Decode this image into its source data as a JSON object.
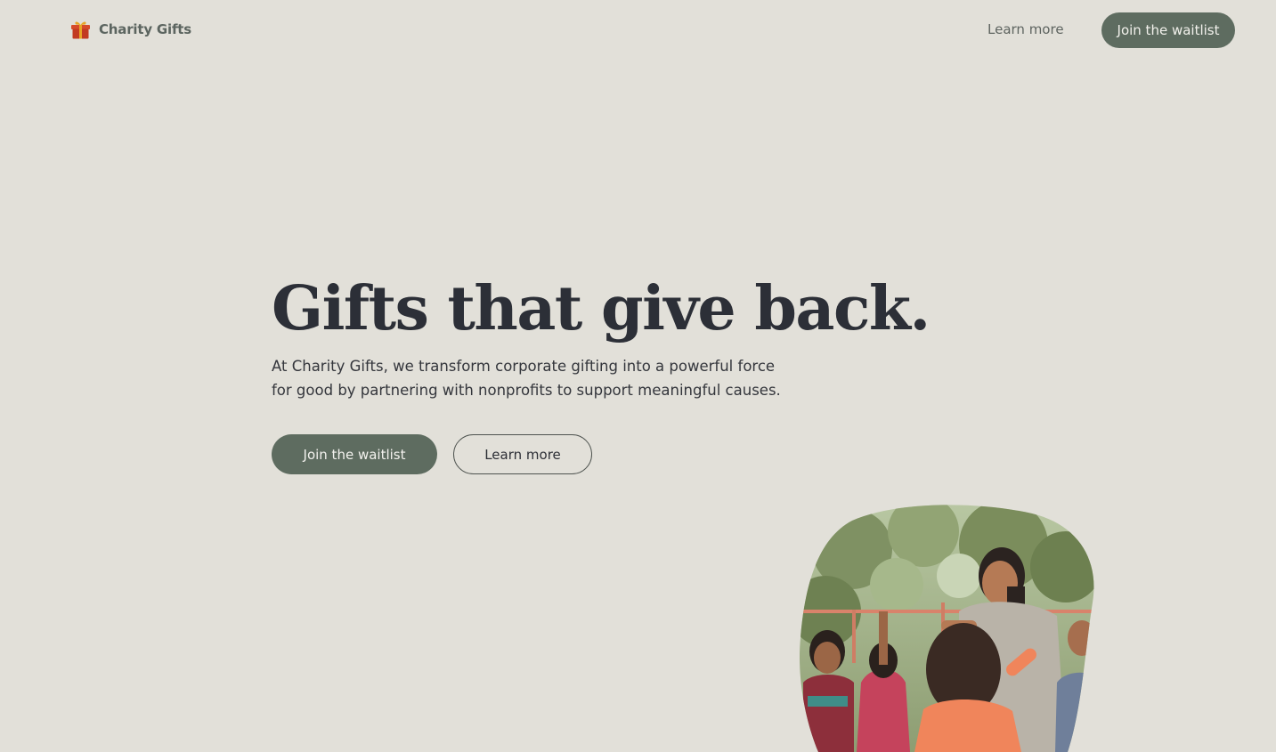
{
  "header": {
    "brand_name": "Charity Gifts",
    "brand_icon": "gift-icon",
    "nav_learn_more": "Learn more",
    "nav_join_waitlist": "Join the waitlist"
  },
  "hero": {
    "title": "Gifts that give back.",
    "subtitle": "At Charity Gifts, we transform corporate gifting into a powerful force for good by partnering with nonprofits to support meaningful causes.",
    "primary_button": "Join the waitlist",
    "secondary_button": "Learn more"
  },
  "photo": {
    "icon": "hero-photo"
  },
  "colors": {
    "background": "#e2e0d9",
    "accent": "#5e6c60",
    "heading": "#2c2f37",
    "gift_red": "#c23a22",
    "gift_gold": "#e7a526"
  }
}
